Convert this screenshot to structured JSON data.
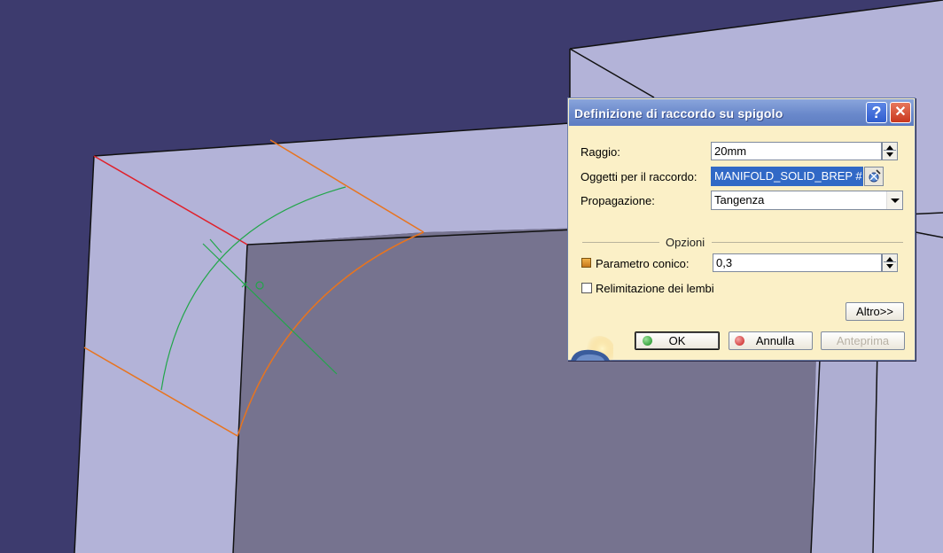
{
  "dialog": {
    "title": "Definizione di raccordo su spigolo",
    "help_label": "?",
    "close_label": "✕",
    "raggio": {
      "label": "Raggio:",
      "value": "20mm"
    },
    "oggetti": {
      "label": "Oggetti per il raccordo:",
      "value": "MANIFOLD_SOLID_BREP #"
    },
    "propagazione": {
      "label": "Propagazione:",
      "value": "Tangenza"
    },
    "opzioni_label": "Opzioni",
    "parametro": {
      "label": "Parametro conico:",
      "value": "0,3"
    },
    "relimitazione_label": "Relimitazione dei lembi",
    "altro_label": "Altro>>",
    "ok_label": "OK",
    "annulla_label": "Annulla",
    "anteprima_label": "Anteprima"
  },
  "colors": {
    "background": "#3d3b6e",
    "dialog_bg": "#fbf0c7",
    "title_bar": "#6a89cb",
    "edge_selected": "#e8741e",
    "edge_red": "#e0202a",
    "manipulator_green": "#22a64a",
    "selection_blue": "#3169c6"
  },
  "icons": [
    "help-icon",
    "close-icon",
    "edge-selection-icon",
    "ok-icon",
    "cancel-icon",
    "spinner-icon",
    "dropdown-arrow-icon"
  ]
}
